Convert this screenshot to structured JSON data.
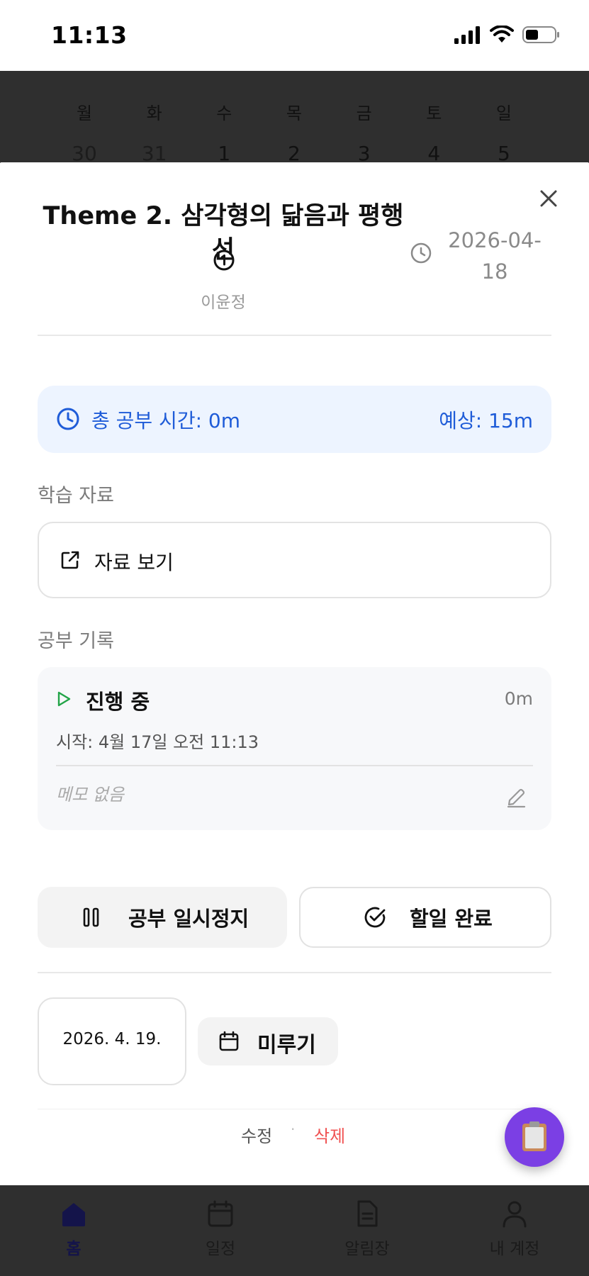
{
  "status_bar": {
    "time": "11:13"
  },
  "calendar_backdrop": {
    "weekdays": [
      "월",
      "화",
      "수",
      "목",
      "금",
      "토",
      "일"
    ],
    "dates": [
      "30",
      "31",
      "1",
      "2",
      "3",
      "4",
      "5"
    ]
  },
  "sheet": {
    "title": "Theme 2. 삼각형의 닮음과 평행선",
    "author": "이윤정",
    "due_date": "2026-04-18",
    "total_study": {
      "label": "총 공부 시간: 0m",
      "expected": "예상: 15m"
    },
    "materials_section": "학습 자료",
    "material_button": "자료 보기",
    "record_section": "공부 기록",
    "record": {
      "status": "진행 중",
      "duration": "0m",
      "start": "시작: 4월 17일 오전 11:13",
      "memo": "메모 없음"
    },
    "pause_button": "공부 일시정지",
    "done_button": "할일 완료",
    "postpone_date": "2026. 4. 19.",
    "postpone_button": "미루기",
    "edit_link": "수정",
    "separator": "·",
    "delete_link": "삭제"
  },
  "bottom_nav": [
    {
      "label": "홈",
      "icon": "home-icon",
      "active": true
    },
    {
      "label": "일정",
      "icon": "calendar-icon",
      "active": false
    },
    {
      "label": "알림장",
      "icon": "document-icon",
      "active": false
    },
    {
      "label": "내 계정",
      "icon": "person-icon",
      "active": false
    }
  ],
  "colors": {
    "accent_blue": "#1f5cd8",
    "fab_purple": "#7b3fe4",
    "delete_red": "#f05252",
    "play_green": "#22a447"
  }
}
